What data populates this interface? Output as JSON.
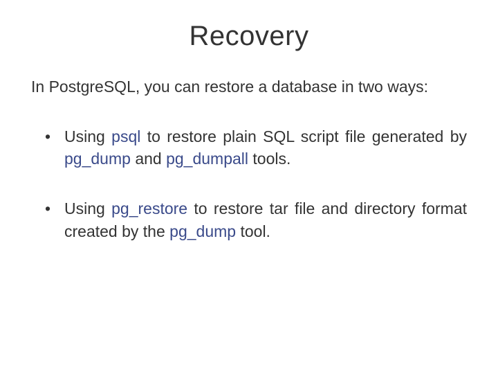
{
  "title": "Recovery",
  "intro": "In PostgreSQL, you can restore a database in two ways:",
  "bullets": [
    {
      "pre1": "Using",
      "kw1": "psql",
      "mid1": " to restore plain SQL script file generated by",
      "kw2": "pg_dump",
      "mid2": "and ",
      "kw3": "pg_dumpall",
      "post": "tools."
    },
    {
      "pre1": "Using",
      "kw1": "pg_restore",
      "mid1": "to restore tar file and directory format created by the",
      "kw2": "pg_dump",
      "post": "tool."
    }
  ]
}
